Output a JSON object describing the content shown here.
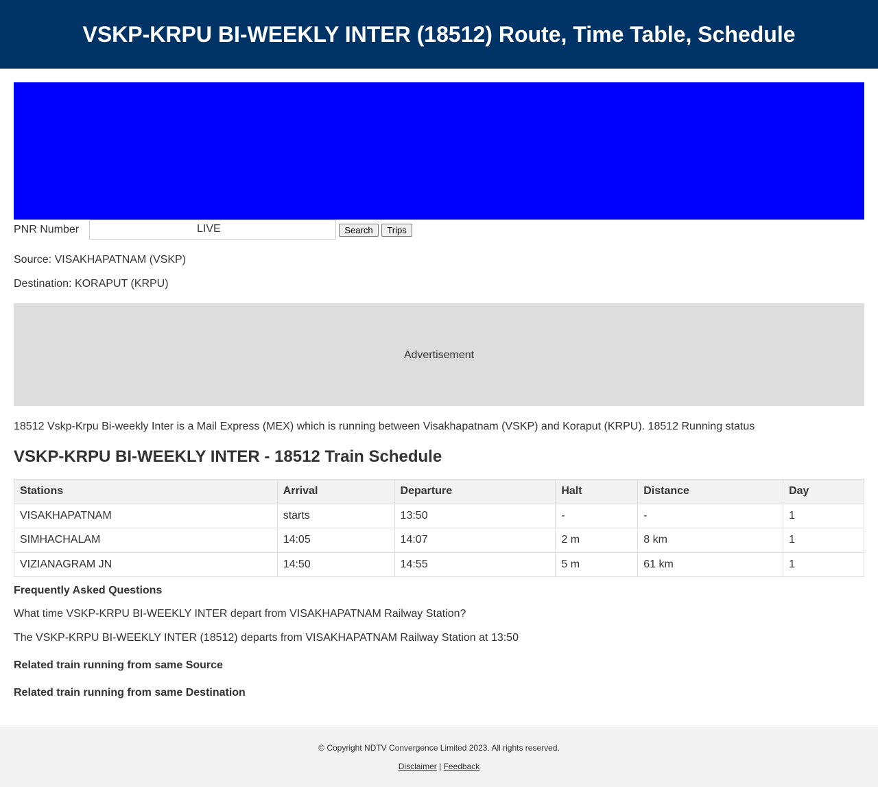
{
  "header": {
    "title": "VSKP-KRPU BI-WEEKLY INTER (18512) Route, Time Table, Schedule"
  },
  "pnr": {
    "label": "PNR Number",
    "input_value": "",
    "live_label": "LIVE",
    "search_label": "Search",
    "trips_label": "Trips"
  },
  "info": {
    "source": "Source: VISAKHAPATNAM (VSKP)",
    "destination": "Destination: KORAPUT (KRPU)"
  },
  "ad": {
    "label": "Advertisement"
  },
  "description": "18512 Vskp-Krpu Bi-weekly Inter is a Mail Express (MEX) which is running between Visakhapatnam (VSKP) and Koraput (KRPU). 18512 Running status",
  "schedule": {
    "title": "VSKP-KRPU BI-WEEKLY INTER - 18512 Train Schedule",
    "headers": [
      "Stations",
      "Arrival",
      "Departure",
      "Halt",
      "Distance",
      "Day"
    ],
    "rows": [
      [
        "VISAKHAPATNAM",
        "starts",
        "13:50",
        "-",
        "-",
        "1"
      ],
      [
        "SIMHACHALAM",
        "14:05",
        "14:07",
        "2 m",
        "8 km",
        "1"
      ],
      [
        "VIZIANAGRAM JN",
        "14:50",
        "14:55",
        "5 m",
        "61 km",
        "1"
      ]
    ]
  },
  "faq": {
    "title": "Frequently Asked Questions",
    "question": "What time VSKP-KRPU BI-WEEKLY INTER depart from VISAKHAPATNAM Railway Station?",
    "answer": "The VSKP-KRPU BI-WEEKLY INTER (18512) departs from VISAKHAPATNAM Railway Station at 13:50"
  },
  "related": {
    "source": "Related train running from same Source",
    "destination": "Related train running from same Destination"
  },
  "footer": {
    "copyright": "© Copyright NDTV Convergence Limited 2023. All rights reserved.",
    "disclaimer": "Disclaimer",
    "separator": "|",
    "feedback": "Feedback"
  },
  "colors": {
    "header_bg": "#003366",
    "ad_banner": "#0000ff",
    "ad_box": "#dddddd",
    "footer_bg": "#f2f2f2"
  }
}
